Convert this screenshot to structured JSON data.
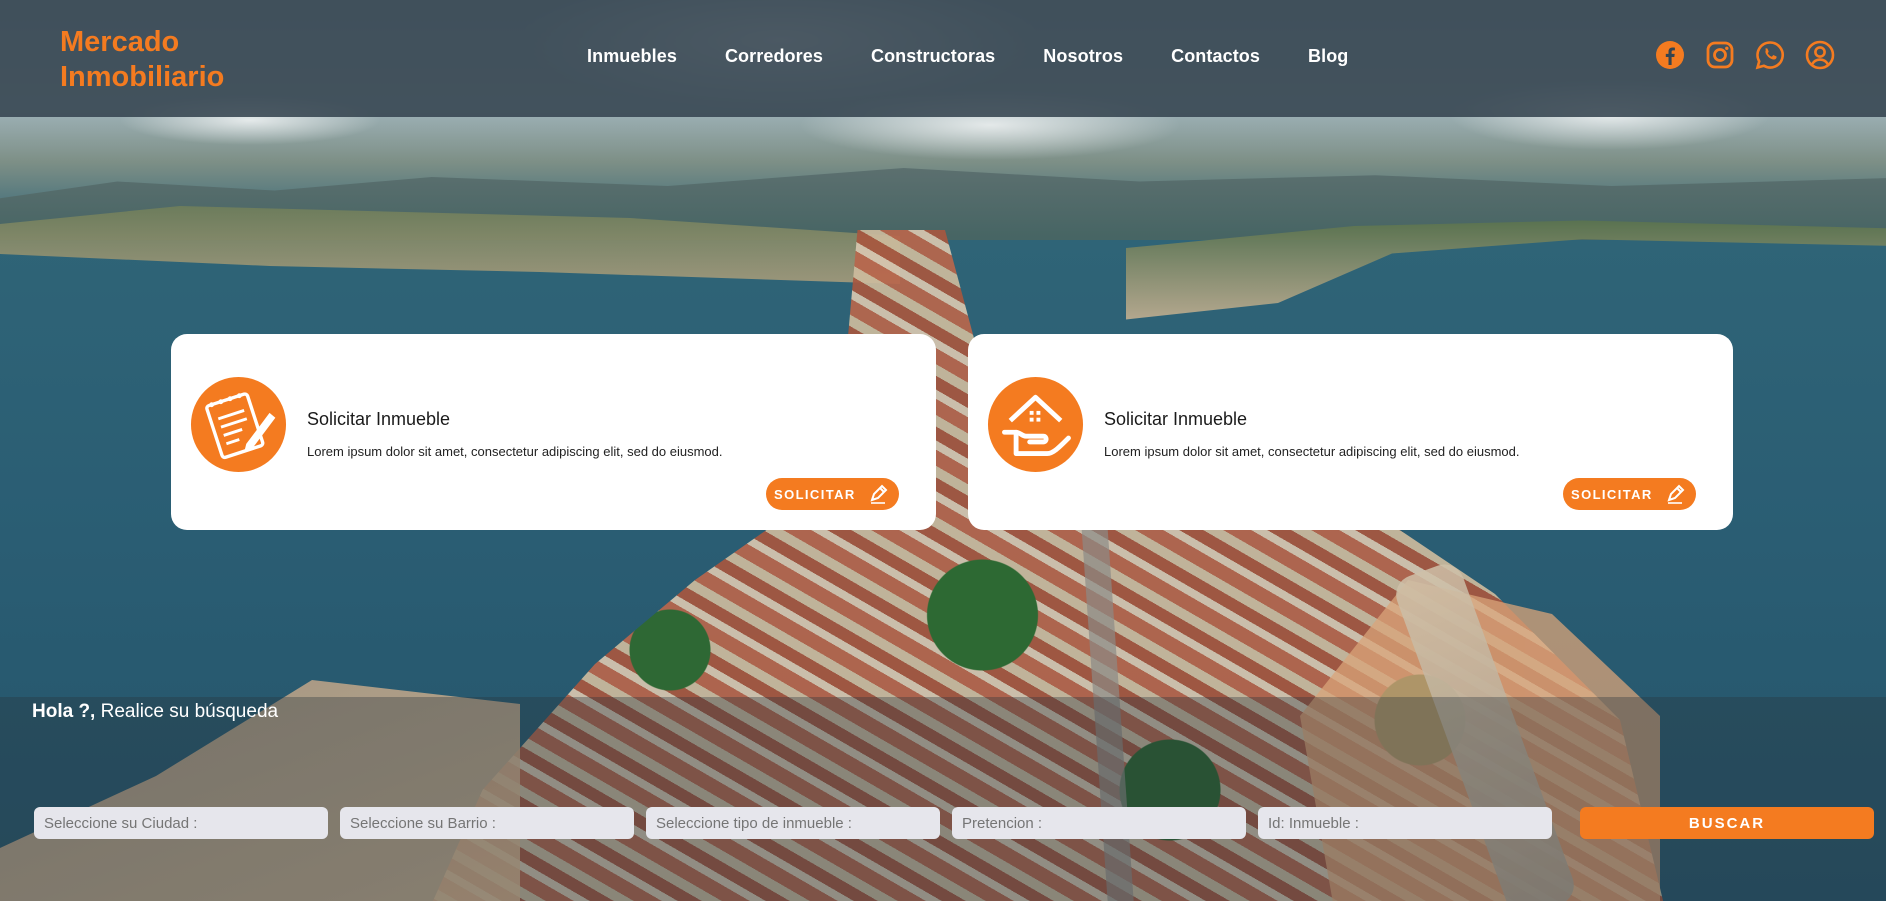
{
  "brand": {
    "line1": "Mercado",
    "line2": "Inmobiliario",
    "color": "#f47b20"
  },
  "nav": {
    "items": [
      "Inmuebles",
      "Corredores",
      "Constructoras",
      "Nosotros",
      "Contactos",
      "Blog"
    ]
  },
  "social": {
    "icons": [
      "facebook-icon",
      "instagram-icon",
      "whatsapp-icon",
      "user-account-icon"
    ]
  },
  "cards": [
    {
      "icon": "notepad-pencil-icon",
      "title": "Solicitar Inmueble",
      "description": "Lorem ipsum dolor sit amet, consectetur adipiscing elit, sed do eiusmod.",
      "button_label": "SOLICITAR",
      "button_icon": "pen-icon"
    },
    {
      "icon": "house-in-hand-icon",
      "title": "Solicitar Inmueble",
      "description": "Lorem ipsum dolor sit amet, consectetur adipiscing elit, sed do eiusmod.",
      "button_label": "SOLICITAR",
      "button_icon": "pen-icon"
    }
  ],
  "search": {
    "greeting_bold": "Hola ?,",
    "greeting_rest": " Realice su búsqueda",
    "fields": [
      {
        "placeholder": "Seleccione su Ciudad :",
        "value": ""
      },
      {
        "placeholder": "Seleccione su Barrio :",
        "value": ""
      },
      {
        "placeholder": "Seleccione tipo de inmueble :",
        "value": ""
      },
      {
        "placeholder": "Pretencion :",
        "value": ""
      },
      {
        "placeholder": "Id: Inmueble :",
        "value": ""
      }
    ],
    "button_label": "BUSCAR"
  },
  "colors": {
    "accent": "#f47b20",
    "header_bg": "#354450",
    "field_bg": "#e6e6ec"
  }
}
